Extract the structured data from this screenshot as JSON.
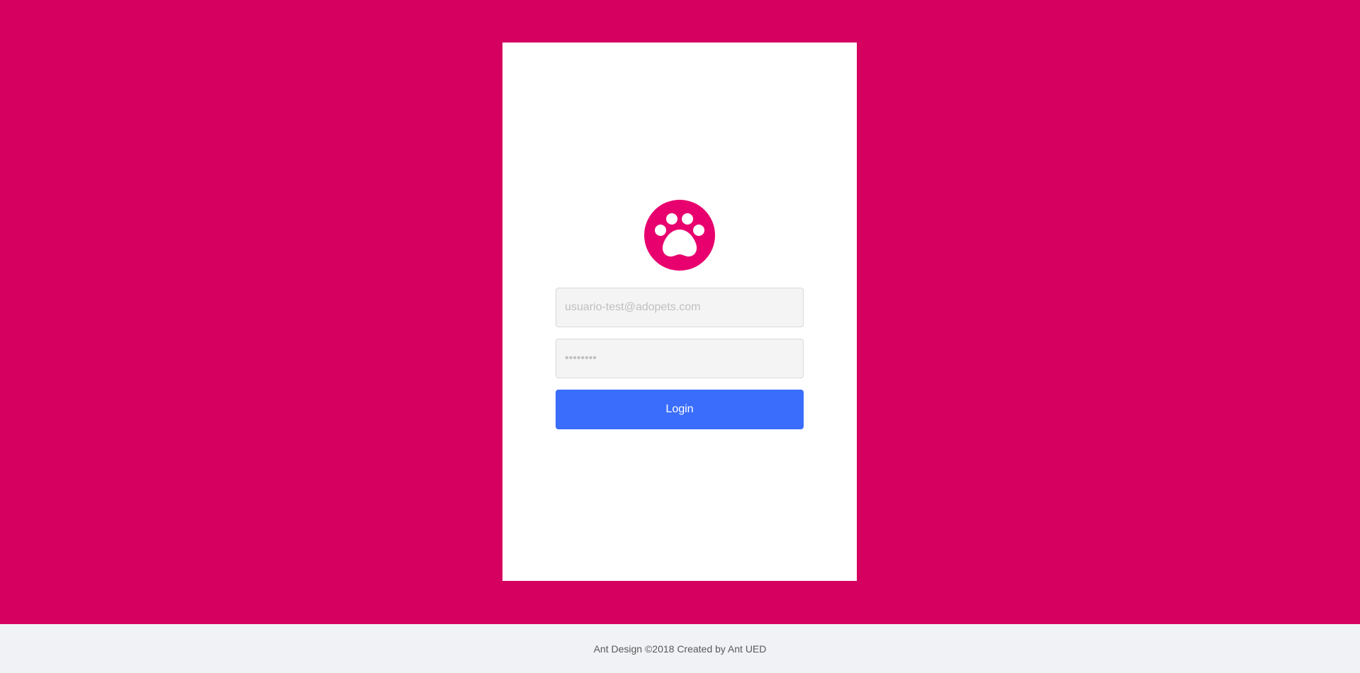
{
  "colors": {
    "background": "#d60060",
    "card": "#ffffff",
    "logo": "#e8006e",
    "button": "#3a6dfb",
    "footer_background": "#f0f2f5"
  },
  "logo": {
    "icon": "paw-icon"
  },
  "login_form": {
    "email_placeholder": "usuario-test@adopets.com",
    "password_placeholder": "••••••••",
    "login_label": "Login"
  },
  "footer": {
    "text": "Ant Design ©2018 Created by Ant UED"
  }
}
